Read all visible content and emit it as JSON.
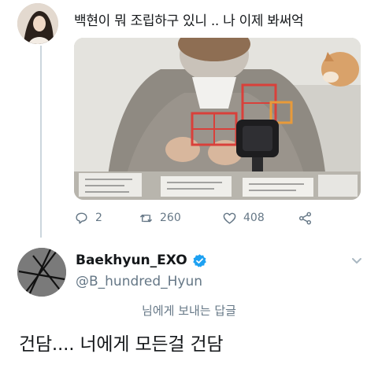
{
  "tweet": {
    "text": "백현이 뭐 조립하구 있니 .. 나 이제 봐써억",
    "stats": {
      "replies": "2",
      "retweets": "260",
      "likes": "408"
    }
  },
  "reply": {
    "display_name": "Baekhyun_EXO",
    "handle": "@B_hundred_Hyun",
    "replying_to": "님에게 보내는 답글",
    "text": "건담.... 너에게 모든걸 건담"
  },
  "colors": {
    "verified": "#1da1f2",
    "secondary_text": "#657786",
    "thread_line": "#ccd6dd"
  },
  "icons": [
    "reply-icon",
    "retweet-icon",
    "like-icon",
    "share-icon",
    "verified-badge-icon",
    "chevron-down-icon"
  ]
}
